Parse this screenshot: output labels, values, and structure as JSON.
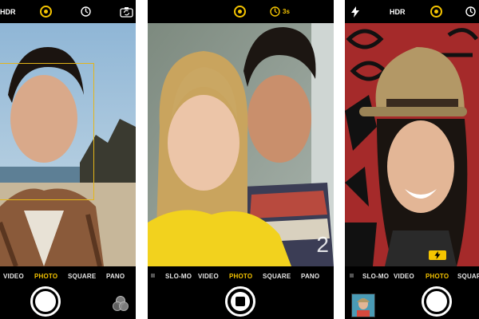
{
  "colors": {
    "accent": "#f5c400",
    "bar_background": "#000000",
    "mode_text": "#e6e6e6"
  },
  "phones": [
    {
      "top_bar": {
        "hdr_label": "HDR",
        "icons": [
          "live-photo-icon",
          "timer-icon",
          "switch-camera-icon"
        ]
      },
      "modes": [
        "VIDEO",
        "PHOTO",
        "SQUARE",
        "PANO"
      ],
      "active_mode": "PHOTO",
      "shutter": "photo",
      "bottom_icons": [
        "filters-icon"
      ]
    },
    {
      "top_bar": {
        "icons": [
          "live-photo-icon",
          "timer-icon"
        ],
        "timer_label": "3s"
      },
      "modes": [
        "SLO-MO",
        "VIDEO",
        "PHOTO",
        "SQUARE",
        "PANO"
      ],
      "active_mode": "PHOTO",
      "shutter": "video",
      "overlay_text": "2"
    },
    {
      "top_bar": {
        "hdr_label": "HDR",
        "icons": [
          "flash-icon",
          "live-photo-icon",
          "timer-icon"
        ]
      },
      "modes": [
        "SLO-MO",
        "VIDEO",
        "PHOTO",
        "SQUARE"
      ],
      "active_mode": "PHOTO",
      "shutter": "photo",
      "bottom_icons": [
        "flash-indicator-icon",
        "photo-thumbnail"
      ]
    }
  ]
}
